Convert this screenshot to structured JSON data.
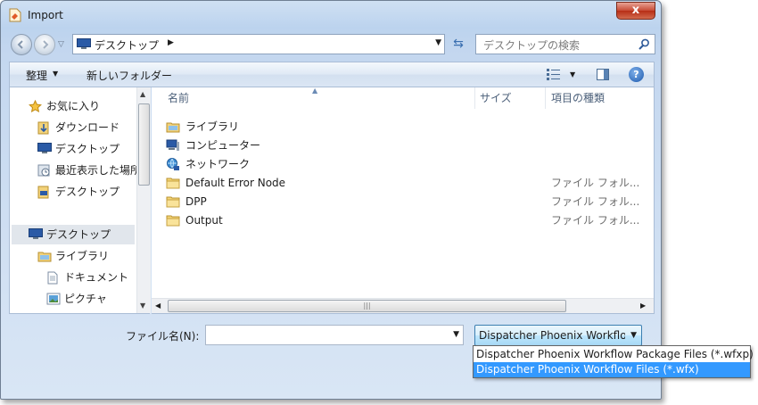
{
  "window": {
    "title": "Import",
    "close_label": "x"
  },
  "address_bar": {
    "location": "デスクトップ"
  },
  "search": {
    "placeholder": "デスクトップの検索"
  },
  "toolbar": {
    "organize_label": "整理",
    "new_folder_label": "新しいフォルダー",
    "help_label": "?"
  },
  "nav_pane": {
    "items": [
      {
        "label": "お気に入り",
        "icon": "star-icon"
      },
      {
        "label": "ダウンロード",
        "icon": "downloads-icon"
      },
      {
        "label": "デスクトップ",
        "icon": "desktop-icon"
      },
      {
        "label": "最近表示した場所",
        "icon": "recent-places-icon"
      },
      {
        "label": "デスクトップ",
        "icon": "desktop-icon"
      },
      {
        "label": "デスクトップ",
        "icon": "desktop-icon",
        "selected": true
      },
      {
        "label": "ライブラリ",
        "icon": "library-icon"
      },
      {
        "label": "ドキュメント",
        "icon": "documents-icon"
      },
      {
        "label": "ピクチャ",
        "icon": "pictures-icon"
      }
    ]
  },
  "file_list": {
    "columns": {
      "name": "名前",
      "size": "サイズ",
      "type": "項目の種類"
    },
    "rows": [
      {
        "name": "ライブラリ",
        "type": "",
        "icon": "library-icon"
      },
      {
        "name": "コンピューター",
        "type": "",
        "icon": "computer-icon"
      },
      {
        "name": "ネットワーク",
        "type": "",
        "icon": "network-icon"
      },
      {
        "name": "Default Error Node",
        "type": "ファイル フォル...",
        "icon": "folder-icon"
      },
      {
        "name": "DPP",
        "type": "ファイル フォル...",
        "icon": "folder-icon"
      },
      {
        "name": "Output",
        "type": "ファイル フォル...",
        "icon": "folder-icon"
      }
    ]
  },
  "file_name": {
    "label": "ファイル名(N):",
    "value": ""
  },
  "file_type": {
    "selected": "Dispatcher Phoenix Workflow Files (*.wfx)",
    "options": [
      "Dispatcher Phoenix Workflow Package Files (*.wfxp)",
      "Dispatcher Phoenix Workflow Files (*.wfx)"
    ]
  }
}
